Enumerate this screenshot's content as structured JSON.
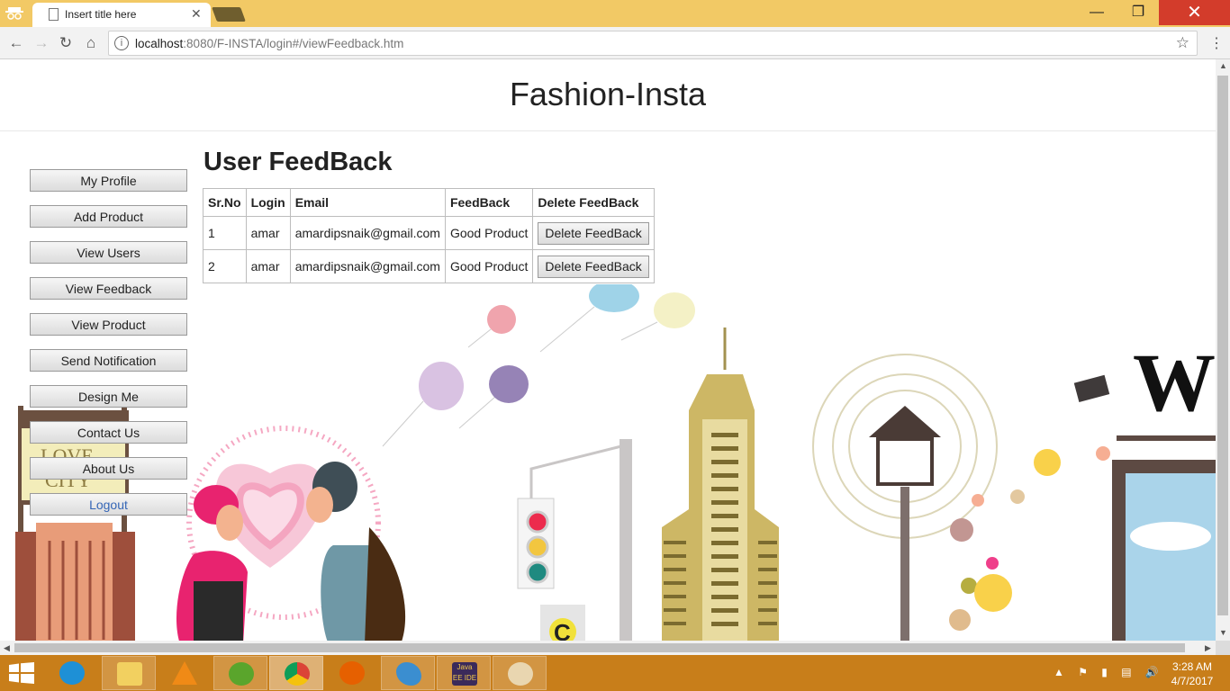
{
  "browser": {
    "tab_title": "Insert title here",
    "tab_close": "✕",
    "url_host": "localhost",
    "url_path": ":8080/F-INSTA/login#/viewFeedback.htm",
    "window_min": "—",
    "window_max": "❐",
    "window_close": "✕"
  },
  "site": {
    "title": "Fashion-Insta"
  },
  "sidebar": {
    "items": [
      {
        "label": "My Profile"
      },
      {
        "label": "Add Product"
      },
      {
        "label": "View Users"
      },
      {
        "label": "View Feedback"
      },
      {
        "label": "View Product"
      },
      {
        "label": "Send Notification"
      },
      {
        "label": "Design Me"
      },
      {
        "label": "Contact Us"
      },
      {
        "label": "About Us"
      },
      {
        "label": "Logout"
      }
    ]
  },
  "main": {
    "title": "User FeedBack",
    "table": {
      "headers": [
        "Sr.No",
        "Login",
        "Email",
        "FeedBack",
        "Delete FeedBack"
      ],
      "rows": [
        {
          "srno": "1",
          "login": "amar",
          "email": "amardipsnaik@gmail.com",
          "feedback": "Good Product",
          "action": "Delete FeedBack"
        },
        {
          "srno": "2",
          "login": "amar",
          "email": "amardipsnaik@gmail.com",
          "feedback": "Good Product",
          "action": "Delete FeedBack"
        }
      ]
    }
  },
  "illustration": {
    "sign_text_1": "LOVE",
    "sign_text_2": "CITY",
    "big_letter": "W",
    "traffic_sign": "C"
  },
  "taskbar": {
    "time": "3:28 AM",
    "date": "4/7/2017",
    "java_label": "Java EE IDE"
  },
  "colors": {
    "titlebar": "#f2c965",
    "taskbar": "#c87e1a",
    "close": "#d33c2b",
    "logout_text": "#3566b6"
  }
}
